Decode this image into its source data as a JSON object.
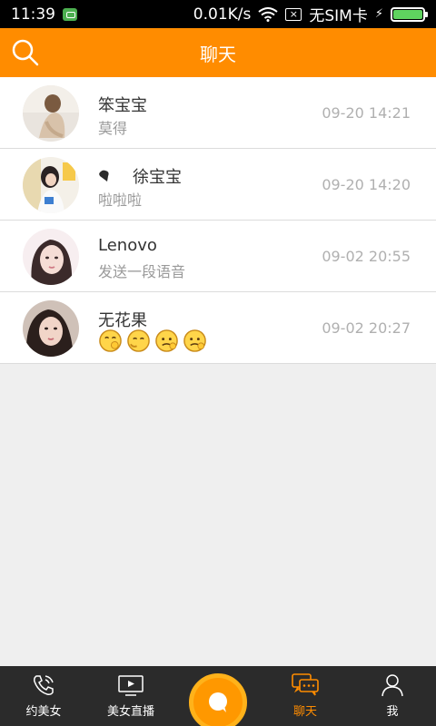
{
  "status_bar": {
    "time": "11:39",
    "network_speed": "0.01K/s",
    "sim_status": "无SIM卡",
    "battery_level": 1.0
  },
  "header": {
    "title": "聊天"
  },
  "chats": [
    {
      "name": "笨宝宝",
      "message": "莫得",
      "time": "09-20 14:21"
    },
    {
      "name": "徐宝宝",
      "message": "啦啦啦",
      "time": "09-20 14:20"
    },
    {
      "name": "Lenovo",
      "message": "发送一段语音",
      "time": "09-02 20:55"
    },
    {
      "name": "无花果",
      "message": "",
      "time": "09-02 20:27"
    }
  ],
  "nav": {
    "items": [
      {
        "label": "约美女"
      },
      {
        "label": "美女直播"
      },
      {
        "label": "聊天"
      },
      {
        "label": "我"
      }
    ]
  },
  "colors": {
    "accent": "#ff8c00",
    "nav_bg": "#2b2b2b",
    "list_bg": "#efefef"
  }
}
